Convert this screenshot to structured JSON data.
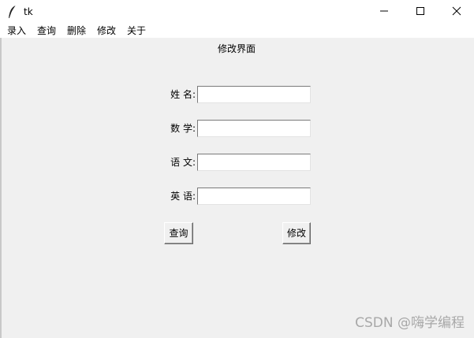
{
  "window": {
    "title": "tk",
    "controls": [
      "minimize",
      "maximize",
      "close"
    ]
  },
  "menubar": {
    "items": [
      {
        "label": "录入"
      },
      {
        "label": "查询"
      },
      {
        "label": "删除"
      },
      {
        "label": "修改"
      },
      {
        "label": "关于"
      }
    ]
  },
  "form": {
    "heading": "修改界面",
    "fields": [
      {
        "label": "姓 名:",
        "value": ""
      },
      {
        "label": "数 学:",
        "value": ""
      },
      {
        "label": "语 文:",
        "value": ""
      },
      {
        "label": "英 语:",
        "value": ""
      }
    ],
    "buttons": {
      "query": "查询",
      "modify": "修改"
    }
  },
  "watermark": "CSDN @嗨学编程",
  "icons": [
    "feather-icon",
    "minimize-icon",
    "maximize-icon",
    "close-icon"
  ]
}
